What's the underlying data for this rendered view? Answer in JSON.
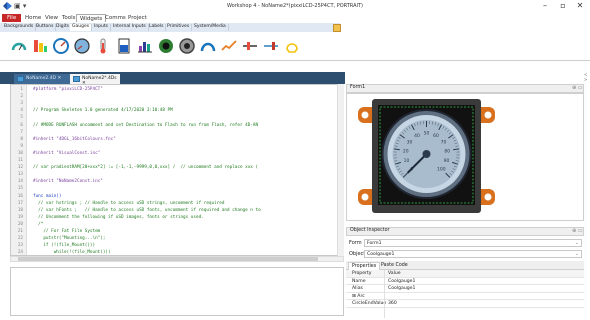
{
  "window": {
    "title": "Workshop 4 - NoName2*(pixxiLCD-25P4CT, PORTRAIT)",
    "minimize": "–",
    "maximize": "▫",
    "close": "✕"
  },
  "menu": {
    "file": "File",
    "items": [
      "Home",
      "View",
      "Tools",
      "Widgets",
      "Comms",
      "Project"
    ]
  },
  "subtabs": [
    "Backgrounds",
    "Buttons",
    "Digits",
    "Gauges",
    "Inputs",
    "Internal Inputs",
    "Labels",
    "Primitives",
    "System/Media"
  ],
  "ribbon_icons": [
    "gauge-icon",
    "bar-meter-icon",
    "angular-meter-icon",
    "coolgauge-icon",
    "thermometer-icon",
    "tank-icon",
    "bar-chart-icon",
    "knob-icon",
    "dial-icon",
    "arc-meter-icon",
    "scope-icon",
    "slider-icon",
    "trend-icon",
    "lamp-icon"
  ],
  "doc_tabs": [
    "NoName2.4D ✕",
    "NoName2*.4Ds ✕"
  ],
  "right_strip": "< >",
  "editor": {
    "line_numbers": [
      "1",
      "2",
      "3",
      "4",
      "5",
      "6",
      "7",
      "8",
      "9",
      "10",
      "11",
      "12",
      "13",
      "14",
      "15",
      "16",
      "17",
      "18",
      "19",
      "20",
      "21",
      "22",
      "23",
      "24"
    ],
    "lines": [
      {
        "t": "#platform \"pixxiLCD-25P4CT\"",
        "c": "pre"
      },
      {
        "t": "",
        "c": "text"
      },
      {
        "t": "",
        "c": "text"
      },
      {
        "t": "// Program Skeleton 1.0 generated 4/17/2020 3:10:48 PM",
        "c": "comment"
      },
      {
        "t": "",
        "c": "text"
      },
      {
        "t": "// #MODE RUNFLASH uncomment and set Destination to Flash to run from Flash, refer 4D-AN",
        "c": "comment"
      },
      {
        "t": "",
        "c": "text"
      },
      {
        "t": "#inherit \"4DGL_16bitColours.fnc\"",
        "c": "pre"
      },
      {
        "t": "",
        "c": "text"
      },
      {
        "t": "#inherit \"VisualConst.inc\"",
        "c": "pre"
      },
      {
        "t": "",
        "c": "text"
      },
      {
        "t": "// var pradientRAM[20+xxx*2] := [-1,-1,-9999,0,0,xxx] /  // uncomment and replace xxx (",
        "c": "comment"
      },
      {
        "t": "",
        "c": "text"
      },
      {
        "t": "#inherit \"NoName2Const.inc\"",
        "c": "pre"
      },
      {
        "t": "",
        "c": "text"
      },
      {
        "t": "func main()",
        "c": "kw"
      },
      {
        "t": "  // var hstrings ; // Handle to access uSD strings, uncomment if required",
        "c": "comment"
      },
      {
        "t": "  // var hFonts ;   // Handle to access uSD fonts, uncomment if required and change n to",
        "c": "comment"
      },
      {
        "t": "  // Uncomment the following if uSD images, fonts or strings used.",
        "c": "comment"
      },
      {
        "t": "  /*",
        "c": "comment"
      },
      {
        "t": "    // For Fat File System",
        "c": "comment"
      },
      {
        "t": "    putstr(\"Mounting...\\n\");",
        "c": "comment"
      },
      {
        "t": "    if (!(file_Mount()))",
        "c": "comment"
      },
      {
        "t": "        while(!(file_Mount()))",
        "c": "comment"
      }
    ]
  },
  "form": {
    "title": "Form1",
    "pin": "⊕ ▭",
    "gauge": {
      "value": 0,
      "tick_labels": [
        "0",
        "10",
        "20",
        "30",
        "40",
        "50",
        "60",
        "70",
        "80",
        "90",
        "100"
      ]
    }
  },
  "inspector": {
    "title": "Object Inspector",
    "pin": "⊕ ▭",
    "form_label": "Form",
    "form_value": "Form1",
    "object_label": "Object",
    "object_value": "Coolgauge1",
    "tabs": [
      "Properties",
      "Paste Code"
    ],
    "properties": [
      {
        "name": "Property",
        "value": "Value"
      },
      {
        "name": "Name",
        "value": "Coolgauge1"
      },
      {
        "name": "Alias",
        "value": "Coolgauge1"
      },
      {
        "name": "⊞ Arc",
        "value": ""
      },
      {
        "name": "CircleEndValue",
        "value": "360"
      }
    ]
  },
  "colors": {
    "file_tab": "#c62828",
    "doc_tab_bar": "#2d4e6e",
    "board_orange": "#d9701e",
    "bezel": "#3a3a3a"
  }
}
